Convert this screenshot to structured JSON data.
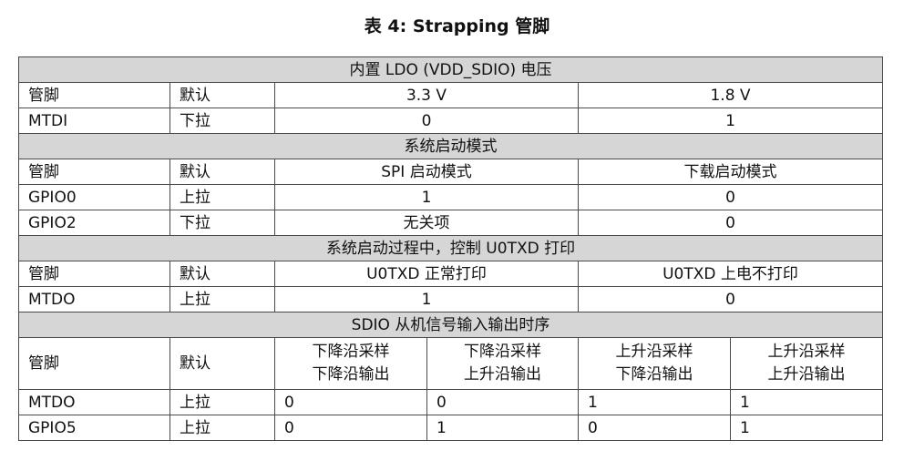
{
  "caption": "表 4: Strapping 管脚",
  "header_labels": {
    "pin": "管脚",
    "default": "默认"
  },
  "sections": [
    {
      "title": "内置 LDO (VDD_SDIO) 电压",
      "cols": [
        "3.3 V",
        "1.8 V"
      ],
      "rows": [
        {
          "pin": "MTDI",
          "default": "下拉",
          "values": [
            "0",
            "1"
          ]
        }
      ]
    },
    {
      "title": "系统启动模式",
      "cols": [
        "SPI 启动模式",
        "下载启动模式"
      ],
      "rows": [
        {
          "pin": "GPIO0",
          "default": "上拉",
          "values": [
            "1",
            "0"
          ]
        },
        {
          "pin": "GPIO2",
          "default": "下拉",
          "values": [
            "无关项",
            "0"
          ]
        }
      ]
    },
    {
      "title": "系统启动过程中，控制 U0TXD 打印",
      "cols": [
        "U0TXD 正常打印",
        "U0TXD 上电不打印"
      ],
      "rows": [
        {
          "pin": "MTDO",
          "default": "上拉",
          "values": [
            "1",
            "0"
          ]
        }
      ]
    },
    {
      "title": "SDIO 从机信号输入输出时序",
      "cols": [
        [
          "下降沿采样",
          "下降沿输出"
        ],
        [
          "下降沿采样",
          "上升沿输出"
        ],
        [
          "上升沿采样",
          "下降沿输出"
        ],
        [
          "上升沿采样",
          "上升沿输出"
        ]
      ],
      "rows": [
        {
          "pin": "MTDO",
          "default": "上拉",
          "values": [
            "0",
            "0",
            "1",
            "1"
          ]
        },
        {
          "pin": "GPIO5",
          "default": "上拉",
          "values": [
            "0",
            "1",
            "0",
            "1"
          ]
        }
      ]
    }
  ]
}
